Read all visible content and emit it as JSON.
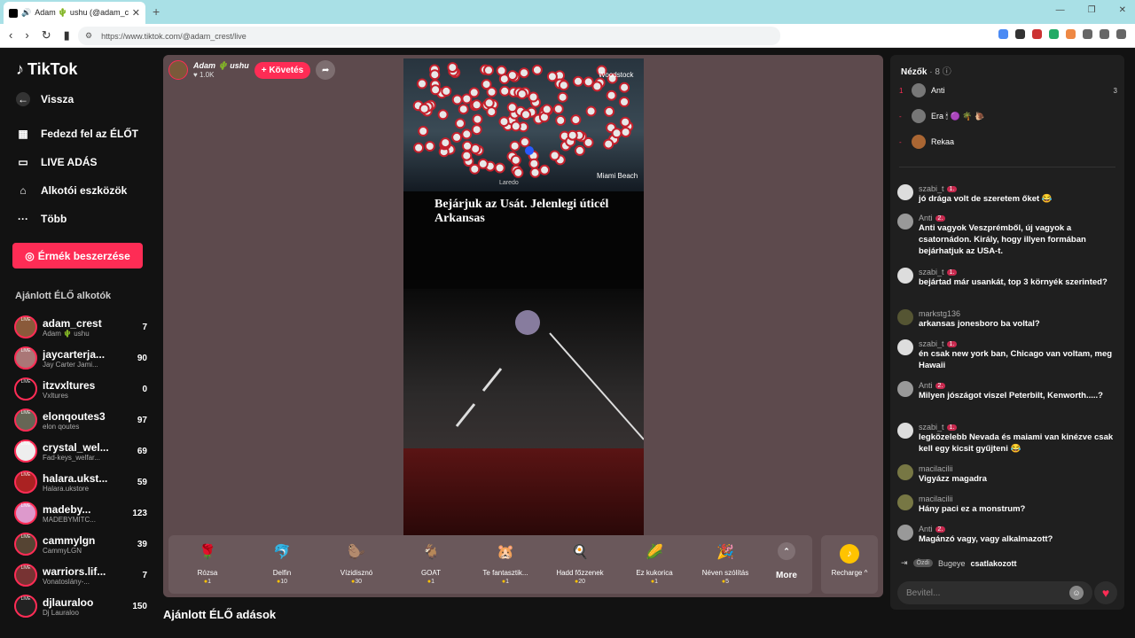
{
  "browser": {
    "tab_title": "Adam 🌵 ushu (@adam_crest",
    "url": "https://www.tiktok.com/@adam_crest/live"
  },
  "sidebar": {
    "logo": "TikTok",
    "back": "Vissza",
    "nav": [
      "Fedezd fel az ÉLŐT",
      "LIVE ADÁS",
      "Alkotói eszközök",
      "Több"
    ],
    "coins_button": "Érmék beszerzése",
    "recommended_title": "Ajánlott ÉLŐ alkotók",
    "creators": [
      {
        "name": "adam_crest",
        "sub": "Adam 🌵 ushu",
        "count": "7"
      },
      {
        "name": "jaycarterja...",
        "sub": "Jay Carter Jami...",
        "count": "90"
      },
      {
        "name": "itzvxltures",
        "sub": "Vxltures",
        "count": "0"
      },
      {
        "name": "elonqoutes3",
        "sub": "elon qoutes",
        "count": "97"
      },
      {
        "name": "crystal_wel...",
        "sub": "Fad-keys_welfar...",
        "count": "69"
      },
      {
        "name": "halara.ukst...",
        "sub": "Halara.ukstore",
        "count": "59"
      },
      {
        "name": "madeby...",
        "sub": "MADEBYMITC...",
        "count": "123"
      },
      {
        "name": "cammylgn",
        "sub": "CammyLGN",
        "count": "39"
      },
      {
        "name": "warriors.lif...",
        "sub": "Vonatoslány-...",
        "count": "7"
      },
      {
        "name": "djlauraloo",
        "sub": "Dj Lauraloo",
        "count": "150"
      }
    ]
  },
  "player": {
    "host_name": "Adam 🌵 ushu",
    "host_likes": "♥ 1.0K",
    "follow_label": "+ Követés",
    "video_text_line1": "Bejárjuk az Usát. Jelenlegi úticél",
    "video_text_line2": "Arkansas",
    "map_labels": [
      "Woodstock",
      "Miami Beach",
      "Laredo"
    ]
  },
  "gifts": [
    {
      "name": "Rózsa",
      "price": "1",
      "icon": "🌹"
    },
    {
      "name": "Delfin",
      "price": "10",
      "icon": "🐬"
    },
    {
      "name": "Vízidisznó",
      "price": "30",
      "icon": "🦫"
    },
    {
      "name": "GOAT",
      "price": "1",
      "icon": "🐐"
    },
    {
      "name": "Te fantasztik...",
      "price": "1",
      "icon": "🐹"
    },
    {
      "name": "Hadd főzzenek",
      "price": "20",
      "icon": "🍳"
    },
    {
      "name": "Ez kukorica",
      "price": "1",
      "icon": "🌽"
    },
    {
      "name": "Néven szólítás",
      "price": "5",
      "icon": "🎉"
    }
  ],
  "more_label": "More",
  "recharge_label": "Recharge ^",
  "below_title": "Ajánlott ÉLŐ adások",
  "chat": {
    "viewers_title": "Nézők",
    "viewers_count": "· 8",
    "viewers": [
      {
        "rank": "1",
        "name": "Anti",
        "score": "3"
      },
      {
        "rank": "-",
        "name": "Era 🕯 🟣 🌴 🐌",
        "score": ""
      },
      {
        "rank": "-",
        "name": "Rekaa",
        "score": ""
      }
    ],
    "messages": [
      {
        "user": "szabi_t",
        "badge": "1.",
        "text": "jó drága volt de szeretem őket 😂"
      },
      {
        "user": "Anti",
        "badge": "2.",
        "text": "Anti vagyok Veszprémből, új vagyok a csatornádon. Király, hogy illyen formában bejárhatjuk az USA-t."
      },
      {
        "user": "szabi_t",
        "badge": "1.",
        "text": "bejártad már usankát, top 3 környék szerinted?"
      },
      {
        "user": "markstg136",
        "badge": "",
        "text": "arkansas jonesboro ba voltal?"
      },
      {
        "user": "szabi_t",
        "badge": "1.",
        "text": "én csak new york ban, Chicago van voltam, meg Hawaii"
      },
      {
        "user": "Anti",
        "badge": "2.",
        "text": "Milyen jószágot viszel Peterbilt, Kenworth.....?"
      },
      {
        "user": "szabi_t",
        "badge": "1.",
        "text": "legközelebb Nevada és maiami van kinézve csak kell egy kicsit gyűjteni 😂"
      },
      {
        "user": "macilacilii",
        "badge": "",
        "text": "Vigyázz magadra"
      },
      {
        "user": "macilacilii",
        "badge": "",
        "text": "Hány paci ez a monstrum?"
      },
      {
        "user": "Anti",
        "badge": "2.",
        "text": "Magánzó vagy, vagy alkalmazott?"
      }
    ],
    "joined_badge": "Özdi",
    "joined_user": "Bugeye",
    "joined_text": "csatlakozott",
    "input_placeholder": "Bevitel..."
  }
}
